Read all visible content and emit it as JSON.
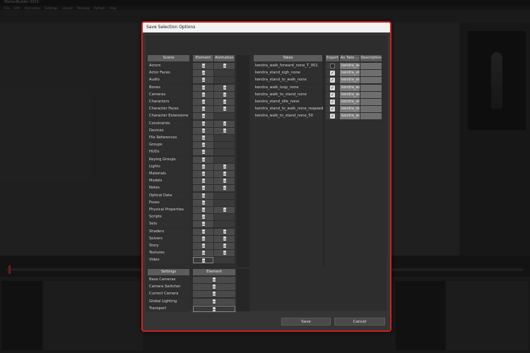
{
  "app": {
    "title": "MotionBuilder 2023",
    "menu": [
      "File",
      "Edit",
      "Animation",
      "Settings",
      "Layout",
      "Window",
      "Python",
      "Help"
    ]
  },
  "dialog": {
    "title": "Save Selection Options",
    "scene_header": "Scene",
    "element_header": "Element",
    "animation_header": "Animation",
    "scene_rows": [
      {
        "label": "Actors",
        "element": true,
        "animation": true
      },
      {
        "label": "Actor Faces",
        "element": true,
        "animation": false
      },
      {
        "label": "Audio",
        "element": true,
        "animation": false
      },
      {
        "label": "Bones",
        "element": true,
        "animation": true
      },
      {
        "label": "Cameras",
        "element": true,
        "animation": true
      },
      {
        "label": "Characters",
        "element": true,
        "animation": true
      },
      {
        "label": "Character Faces",
        "element": true,
        "animation": true
      },
      {
        "label": "Character Extensions",
        "element": true,
        "animation": false
      },
      {
        "label": "Constraints",
        "element": true,
        "animation": true
      },
      {
        "label": "Devices",
        "element": true,
        "animation": true
      },
      {
        "label": "File References",
        "element": true,
        "animation": false
      },
      {
        "label": "Groups",
        "element": true,
        "animation": false
      },
      {
        "label": "HUDs",
        "element": true,
        "animation": false
      },
      {
        "label": "Keying Groups",
        "element": true,
        "animation": false
      },
      {
        "label": "Lights",
        "element": true,
        "animation": true
      },
      {
        "label": "Materials",
        "element": true,
        "animation": true
      },
      {
        "label": "Models",
        "element": true,
        "animation": true
      },
      {
        "label": "Notes",
        "element": true,
        "animation": true
      },
      {
        "label": "Optical Data",
        "element": true,
        "animation": false
      },
      {
        "label": "Poses",
        "element": true,
        "animation": false
      },
      {
        "label": "Physical Properties",
        "element": true,
        "animation": true
      },
      {
        "label": "Scripts",
        "element": true,
        "animation": false
      },
      {
        "label": "Sets",
        "element": true,
        "animation": false
      },
      {
        "label": "Shaders",
        "element": true,
        "animation": true
      },
      {
        "label": "Solvers",
        "element": true,
        "animation": true
      },
      {
        "label": "Story",
        "element": true,
        "animation": true
      },
      {
        "label": "Textures",
        "element": true,
        "animation": true
      },
      {
        "label": "Video",
        "element": true,
        "animation": false
      }
    ],
    "settings_header": "Settings",
    "settings_element_header": "Element",
    "settings_rows": [
      "Base Cameras",
      "Camera Switcher",
      "Current Camera",
      "Global Lighting",
      "Transport"
    ],
    "takes_header": "Takes",
    "export_header": "Export",
    "as_take_header": "As Take ...",
    "description_header": "Description",
    "takes": [
      {
        "name": "kendra_walk_forward_none_T_001",
        "export": false,
        "as_take": "kendra_walk"
      },
      {
        "name": "kendra_stand_sigh_none",
        "export": true,
        "as_take": "kendra_stan"
      },
      {
        "name": "kendra_stand_to_walk_none",
        "export": true,
        "as_take": "kendra_stan"
      },
      {
        "name": "kendra_walk_loop_none",
        "export": true,
        "as_take": "kendra_walk"
      },
      {
        "name": "kendra_walk_to_stand_none",
        "export": true,
        "as_take": "kendra_walk"
      },
      {
        "name": "kendra_stand_idle_none",
        "export": true,
        "as_take": "kendra_stan"
      },
      {
        "name": "kendra_stand_to_walk_none_respeed",
        "export": true,
        "as_take": "kendra_stan"
      },
      {
        "name": "kendra_walk_to_stand_none_50",
        "export": true,
        "as_take": "kendra_walk"
      }
    ],
    "save_label": "Save",
    "cancel_label": "Cancel",
    "checkmark": "✓"
  }
}
